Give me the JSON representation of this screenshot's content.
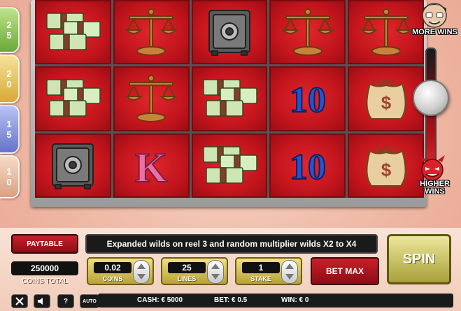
{
  "paylines": [
    "25",
    "20",
    "15",
    "10"
  ],
  "reels": {
    "rows": [
      [
        "money-stack",
        "scales",
        "safe",
        "scales",
        "scales"
      ],
      [
        "money-stack",
        "scales",
        "money-stack",
        "symbol-10",
        "money-bag"
      ],
      [
        "safe",
        "symbol-k",
        "money-stack",
        "symbol-10",
        "money-bag"
      ]
    ]
  },
  "symbol_text": {
    "k": "K",
    "ten": "10",
    "dollar": "$"
  },
  "side": {
    "more_wins": "MORE WINS",
    "higher_wins_1": "HIGHER",
    "higher_wins_2": "WINS"
  },
  "controls": {
    "paytable_label": "PAYTABLE",
    "message": "Expanded wilds on reel 3 and random multiplier wilds X2 to X4",
    "coins_total_value": "250000",
    "coins_total_label": "COINS TOTAL",
    "coins": {
      "value": "0.02",
      "label": "COINS"
    },
    "lines": {
      "value": "25",
      "label": "LINES"
    },
    "stake": {
      "value": "1",
      "label": "STAKE"
    },
    "bet_max_label": "BET MAX",
    "spin_label": "SPIN",
    "auto_label": "AUTO",
    "help_label": "?"
  },
  "status": {
    "cash": "CASH: € 5000",
    "bet": "BET: € 0.5",
    "win": "WIN: € 0"
  },
  "colors": {
    "reel_red": "#c4151d",
    "spin_button": "#ece79a",
    "panel": "#f9e3d6"
  }
}
